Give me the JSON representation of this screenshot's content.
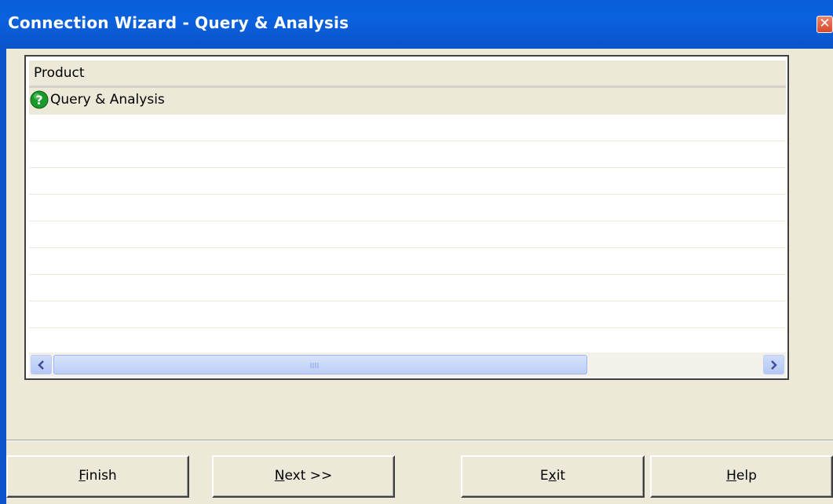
{
  "window": {
    "title": "Connection Wizard - Query & Analysis",
    "close_glyph": "✕"
  },
  "list": {
    "column_header": "Product",
    "rows": [
      {
        "label": "Query & Analysis",
        "icon": "help-question-icon",
        "selected": true
      }
    ],
    "empty_row_count": 9
  },
  "buttons": {
    "finish": {
      "mnemonic": "F",
      "rest": "inish"
    },
    "next": {
      "mnemonic": "N",
      "rest": "ext >>"
    },
    "exit": {
      "before": "E",
      "mnemonic": "x",
      "after": "it"
    },
    "help": {
      "mnemonic": "H",
      "rest": "elp"
    }
  },
  "colors": {
    "titlebar": "#0a5fd8",
    "face": "#ece9d8",
    "icon_green": "#1b9a2c"
  }
}
